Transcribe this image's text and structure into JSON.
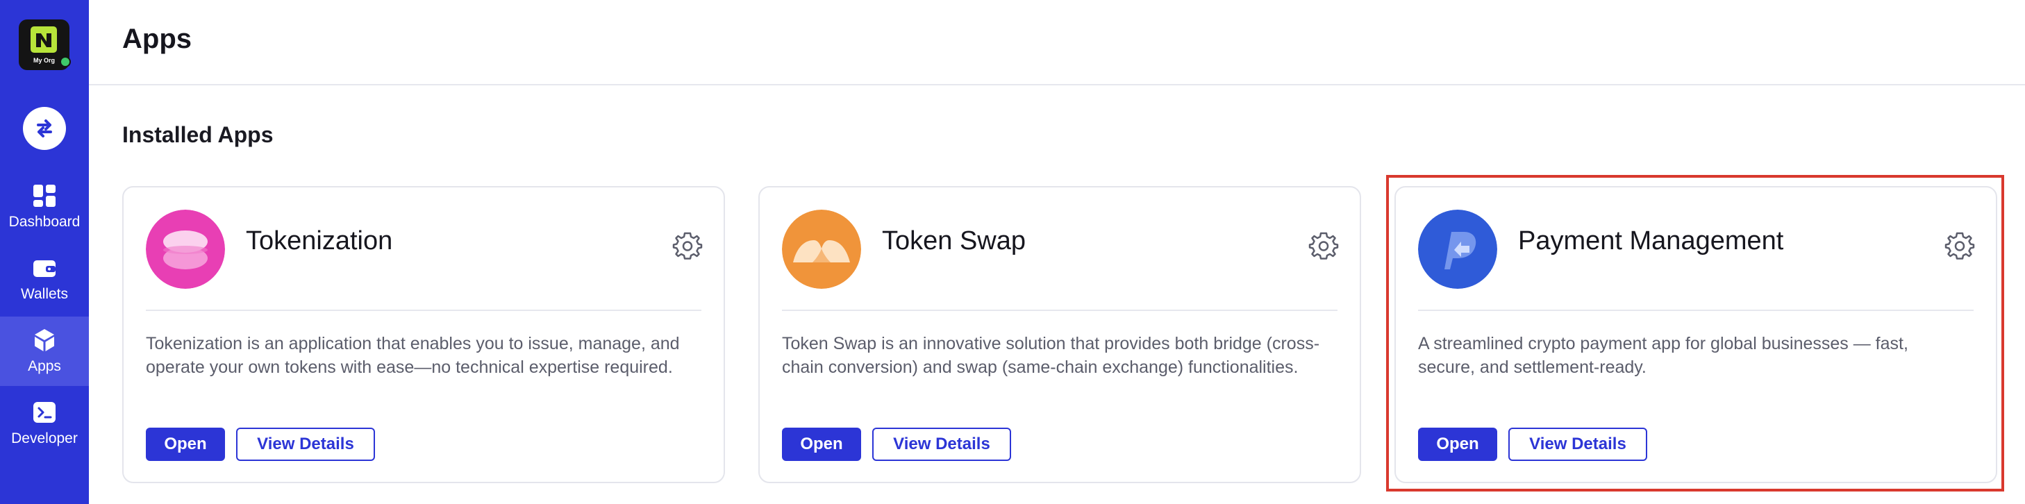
{
  "sidebar": {
    "org": {
      "name": "My Org",
      "status_color": "#3fc96a",
      "logo_color": "#b7e43a"
    },
    "switch_icon": "swap-arrows-icon",
    "items": [
      {
        "label": "Dashboard",
        "icon": "dashboard-icon",
        "active": false
      },
      {
        "label": "Wallets",
        "icon": "wallet-icon",
        "active": false
      },
      {
        "label": "Apps",
        "icon": "cube-icon",
        "active": true
      },
      {
        "label": "Developer",
        "icon": "terminal-icon",
        "active": false
      }
    ],
    "accent": "#2c35d6"
  },
  "header": {
    "title": "Apps"
  },
  "main": {
    "section_title": "Installed Apps",
    "apps": [
      {
        "name": "Tokenization",
        "icon": "tokenization-icon",
        "icon_color": "#e83fb4",
        "description": "Tokenization is an application that enables you to issue, manage, and operate your own tokens with ease—no technical expertise required.",
        "open_label": "Open",
        "details_label": "View Details",
        "settings_icon": "gear-icon"
      },
      {
        "name": "Token Swap",
        "icon": "token-swap-icon",
        "icon_color": "#f0943a",
        "description": "Token Swap is an innovative solution that provides both bridge (cross-chain conversion) and swap (same-chain exchange) functionalities.",
        "open_label": "Open",
        "details_label": "View Details",
        "settings_icon": "gear-icon"
      },
      {
        "name": "Payment Management",
        "icon": "payment-management-icon",
        "icon_color": "#2f5bd8",
        "description": "A streamlined crypto payment app for global businesses — fast, secure, and settlement-ready.",
        "open_label": "Open",
        "details_label": "View Details",
        "settings_icon": "gear-icon",
        "highlighted": true
      }
    ],
    "highlight_color": "#d9392e"
  }
}
